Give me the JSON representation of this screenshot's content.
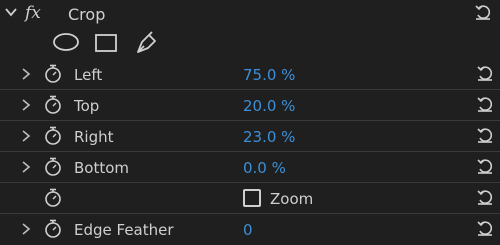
{
  "effect": {
    "fx_glyph": "fx",
    "title": "Crop"
  },
  "mask_tools": [
    "ellipse-mask-icon",
    "rectangle-mask-icon",
    "pen-mask-icon"
  ],
  "rows": [
    {
      "label": "Left",
      "value": "75.0 %"
    },
    {
      "label": "Top",
      "value": "20.0 %"
    },
    {
      "label": "Right",
      "value": "23.0 %"
    },
    {
      "label": "Bottom",
      "value": "0.0 %"
    },
    {
      "checkbox_label": "Zoom"
    },
    {
      "label": "Edge Feather",
      "value": "0"
    }
  ],
  "colors": {
    "background": "#1f1f1f",
    "value_blue": "#3d8fd6",
    "text": "#cfcfcf"
  }
}
